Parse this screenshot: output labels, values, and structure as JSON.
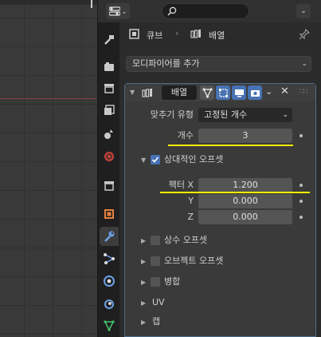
{
  "search": {
    "placeholder": ""
  },
  "breadcrumb": {
    "object": "큐브",
    "modifier": "배열"
  },
  "add_modifier": {
    "label": "모디파이어를 추가"
  },
  "modifier": {
    "name": "배열",
    "fit_type": {
      "label": "맞추기 유형",
      "value": "고정된 개수"
    },
    "count": {
      "label": "개수",
      "value": "3"
    },
    "relative_offset": {
      "label": "상대적인 오프셋",
      "checked": true
    },
    "factor_x": {
      "label": "팩터 X",
      "value": "1.200"
    },
    "factor_y": {
      "label": "Y",
      "value": "0.000"
    },
    "factor_z": {
      "label": "Z",
      "value": "0.000"
    },
    "subpanels": [
      {
        "label": "상수 오프셋"
      },
      {
        "label": "오브젝트 오프셋"
      },
      {
        "label": "병합"
      },
      {
        "label": "UV"
      },
      {
        "label": "캡"
      }
    ]
  },
  "colors": {
    "accent": "#4772b3",
    "highlight": "#f4f400",
    "panel_border": "#4f6b8a"
  }
}
